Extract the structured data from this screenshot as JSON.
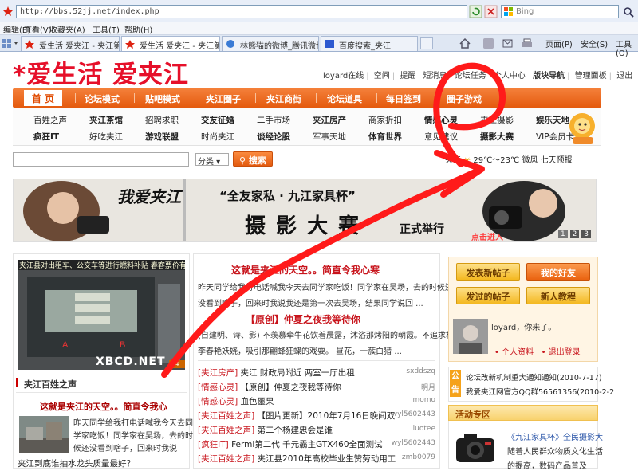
{
  "browser": {
    "url": "http://bbs.52jj.net/index.php",
    "search_placeholder": "Bing",
    "menu": [
      "编辑(E)",
      "查看(V)",
      "收藏夹(A)",
      "工具(T)",
      "帮助(H)"
    ],
    "tabs": [
      {
        "label": "爱生活 爱夹江 - 夹江第一..."
      },
      {
        "label": "爱生活 爱夹江 - 夹江第一生..."
      },
      {
        "label": "林熊猫的微博_腾讯微博"
      },
      {
        "label": "百度搜索_夹江"
      }
    ],
    "toolbar": [
      "页面(P)",
      "安全(S)",
      "工具(O)"
    ]
  },
  "site": {
    "logo": "*爱生活 爱夹江",
    "top_links": [
      "loyard在线",
      "空间",
      "提醒",
      "短消息",
      "论坛任务",
      "个人中心",
      "版块导航",
      "管理面板",
      "退出"
    ],
    "nav": [
      "首 页",
      "论坛模式",
      "贴吧模式",
      "夹江圈子",
      "夹江商街",
      "论坛道具",
      "每日签到",
      "圈子游戏"
    ],
    "subnav_row1": [
      "百姓之声",
      "夹江茶馆",
      "招聘求职",
      "交友征婚",
      "二手市场",
      "夹江房产",
      "商家折扣",
      "情感心灵",
      "夹江摄影",
      "娱乐天地"
    ],
    "subnav_row2": [
      "疯狂IT",
      "好吃夹江",
      "游戏联盟",
      "时尚夹江",
      "谈经论股",
      "军事天地",
      "体育世界",
      "意见建议",
      "摄影大赛",
      "VIP会员卡"
    ],
    "search": {
      "select": "分类",
      "button": "搜索"
    },
    "weather": {
      "city": "夹江",
      "temp": "29℃～23℃",
      "wind": "微风",
      "forecast": "七天预报"
    }
  },
  "banner": {
    "script_title": "我爱夹江",
    "sub": "“全友家私 · 九江家具杯”",
    "big": "摄 影 大 赛",
    "tail": "正式举行",
    "click": "点击进入",
    "pages": [
      "1",
      "2",
      "3"
    ]
  },
  "left": {
    "caption": "夹江县对出租车、公交车等进行燃料补贴 春客票价有下调",
    "watermark": "XBCD.NET",
    "section": "夹江百姓之声",
    "headline": "这就是夹江的天空。。简直令我心",
    "lines": [
      "昨天同学给我打电话喊我今天去同",
      "学家吃饭！同学家在吴场，去的时",
      "候还没看到啥子，回来时我说"
    ],
    "last": "夹江到底谁抽水龙头质量最好？"
  },
  "middle": {
    "head1": "这就是夹江的天空。。简直令我心寒",
    "p1": [
      "昨天同学给我打电话喊我今天去同学家吃饭！同学家在吴场，去的时候还",
      "没看到啥子，回来时我说我还是第一次去吴场，结果同学说回 ..."
    ],
    "head2": "【原创】仲夏之夜我等待你",
    "p2": [
      "(自建明、诗、影) 不羡慕牵牛花饮着晨露，沐浴那烤阳的朝霞。不追求桃",
      "李春艳妖娆，吸引那翩蜂狂蝶的戏耍。 昼花，一蔟白猎 ..."
    ],
    "rows": [
      {
        "tag": "[夹江房产]",
        "title": "夹江 财政局附近 两室一厅出租",
        "author": "sxddszq"
      },
      {
        "tag": "[情感心灵]",
        "title": "【原创】仲夏之夜我等待你",
        "author": "明月"
      },
      {
        "tag": "[情感心灵]",
        "title": "血色噩果",
        "author": "momo"
      },
      {
        "tag": "[夹江百姓之声]",
        "title": "【图片更新】2010年7月16日晚间双",
        "author": "wyl5602443"
      },
      {
        "tag": "[夹江百姓之声]",
        "title": "第二个杨建忠会是谁",
        "author": "luotee"
      },
      {
        "tag": "[疯狂IT]",
        "title": "Fermi第二代 千元霸主GTX460全面测试",
        "author": "wyl5602443"
      },
      {
        "tag": "[夹江百姓之声]",
        "title": "夹江县2010年高校毕业生赞劳动用工",
        "author": "zmb0079"
      }
    ]
  },
  "right": {
    "buttons": [
      "发表新帖子",
      "我的好友",
      "发过的帖子",
      "新人教程"
    ],
    "user": "loyard，你来了。",
    "links": [
      "个人资料",
      "退出登录"
    ],
    "notice_icon": "公告",
    "notices": [
      "论坛改新机制重大通知通知(2010-7-17)",
      "我爱夹江网官方QQ群56561356(2010-2-2"
    ],
    "activity_head": "活动专区",
    "activity": [
      "《九江家具杯》全民摄影大",
      "随着人民群众物质文化生活",
      "的提高，数码产品普及"
    ]
  },
  "colors": {
    "accent": "#e85a12",
    "logo": "#e6102a",
    "annotation": "#ff1a1a"
  }
}
